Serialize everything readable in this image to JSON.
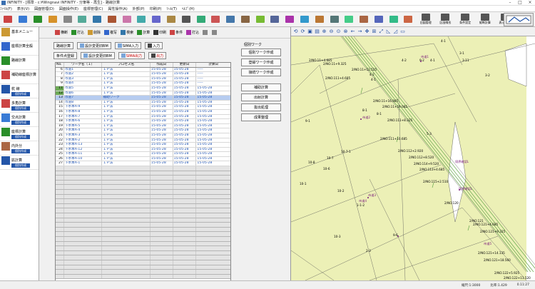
{
  "window": {
    "title": "INFINITY - [標準 - c:¥Wingnavi INFINITY - 分筆等 - 再生] - 路線計算"
  },
  "menu": [
    "ﾌｧｲﾙ(F)",
    "表示(V)",
    "図面管理(D)",
    "図面操作(E)",
    "座標管理(C)",
    "属性操作(A)",
    "外部(P)",
    "印刷(P)",
    "ﾂｰﾙ(T)",
    "ﾍﾙﾌﾟ(H)"
  ],
  "toolbar": [
    "DXF",
    "",
    "",
    "",
    "",
    "",
    "",
    "",
    "",
    "",
    "",
    "",
    "",
    "",
    "",
    "",
    "",
    "",
    "",
    "",
    "",
    "",
    "",
    "",
    "",
    "",
    "",
    ""
  ],
  "toolbar_labels": {
    "kyushin": "旧図管理",
    "tekiyou": "区画線形",
    "jouken": "条件設定",
    "keisan": "縦断計算",
    "hyouji": "表示ﾓｰﾄﾞ",
    "tool": "ツール"
  },
  "sidebar": [
    {
      "label": "基本メニュー"
    },
    {
      "label": "座標計算全般"
    },
    {
      "label": "路線計算"
    },
    {
      "label": "補助線座標計算"
    },
    {
      "label": "杭 線",
      "btn": "個別作成"
    },
    {
      "label": "多角計算",
      "btn": "個別作成"
    },
    {
      "label": "交点計算",
      "btn": "個別作成"
    },
    {
      "label": "座標計算",
      "btn": "個別作成"
    },
    {
      "label": "内外分",
      "btn": "個別作成"
    },
    {
      "label": "拡計算",
      "btn": "個別作成"
    }
  ],
  "subtoolbar": [
    "横断",
    "打込",
    "削除",
    "複写",
    "検索",
    "計算",
    "印刷",
    "条件",
    "打込",
    "",
    ""
  ],
  "controls": {
    "row1": [
      "路線計算",
      "設計変更旧BM",
      "SIMA入力",
      "入力"
    ],
    "row2": [
      "条件点登録",
      "設計変更旧BM",
      "SIMA出力",
      "出力"
    ]
  },
  "right_panel": {
    "heading": "個別ワーク",
    "buttons": [
      "個別ワーク作成",
      "登録ワーク作成",
      "接続ワーク作成"
    ],
    "buttons2": [
      "補助計算",
      "出射計算",
      "抜出処理",
      "成果整理"
    ]
  },
  "grid": {
    "headers": [
      "No.",
      "ワーク名（１）",
      "プロセス名",
      "作成日",
      "更新日",
      "計算日"
    ],
    "rows": [
      {
        "no": "6",
        "name": "市道1",
        "proc": "ＩＰ法",
        "created": "15-05-28",
        "updated": "15-05-28",
        "calc": "-----",
        "type": ""
      },
      {
        "no": "7",
        "name": "市道2",
        "proc": "ＩＰ法",
        "created": "15-05-28",
        "updated": "15-05-28",
        "calc": "-----",
        "type": ""
      },
      {
        "no": "8",
        "name": "市道3",
        "proc": "ＩＰ法",
        "created": "15-05-28",
        "updated": "15-05-28",
        "calc": "-----",
        "type": ""
      },
      {
        "no": "9",
        "name": "市道4",
        "proc": "ＩＰ法",
        "created": "15-05-28",
        "updated": "15-05-28",
        "calc": "-----",
        "type": ""
      },
      {
        "no": "11",
        "name": "市道5",
        "proc": "ＩＰ法",
        "created": "15-05-28",
        "updated": "15-05-28",
        "calc": "15-05-28",
        "type": "green"
      },
      {
        "no": "12",
        "name": "市道6",
        "proc": "ＩＰ法",
        "created": "15-05-28",
        "updated": "15-05-28",
        "calc": "15-05-28",
        "type": "green"
      },
      {
        "no": "13",
        "name": "市道7",
        "proc": "補助ワーク",
        "created": "15-05-28",
        "updated": "15-05-28",
        "calc": "15-05-28",
        "type": "sel"
      },
      {
        "no": "14",
        "name": "市道8",
        "proc": "ＩＰ法",
        "created": "15-05-28",
        "updated": "15-05-28",
        "calc": "15-05-28",
        "type": ""
      },
      {
        "no": "15",
        "name": "下水本A-9",
        "proc": "ＩＰ法",
        "created": "15-05-28",
        "updated": "15-05-28",
        "calc": "15-05-28",
        "type": ""
      },
      {
        "no": "16",
        "name": "下水本A-8",
        "proc": "ＩＰ法",
        "created": "15-05-28",
        "updated": "15-05-28",
        "calc": "15-05-28",
        "type": ""
      },
      {
        "no": "17",
        "name": "下水本A-7",
        "proc": "ＩＰ法",
        "created": "15-05-28",
        "updated": "15-05-28",
        "calc": "15-05-28",
        "type": ""
      },
      {
        "no": "18",
        "name": "下水本A-6",
        "proc": "ＩＰ法",
        "created": "15-05-28",
        "updated": "15-05-28",
        "calc": "15-05-28",
        "type": ""
      },
      {
        "no": "19",
        "name": "下水本A-5",
        "proc": "ＩＰ法",
        "created": "15-05-28",
        "updated": "15-05-28",
        "calc": "15-05-28",
        "type": ""
      },
      {
        "no": "20",
        "name": "下水本A-4",
        "proc": "ＩＰ法",
        "created": "15-05-28",
        "updated": "15-05-28",
        "calc": "15-05-28",
        "type": ""
      },
      {
        "no": "21",
        "name": "下水本A-3",
        "proc": "ＩＰ法",
        "created": "15-05-28",
        "updated": "15-05-28",
        "calc": "15-05-28",
        "type": ""
      },
      {
        "no": "22",
        "name": "下水本A-2",
        "proc": "ＩＰ法",
        "created": "15-05-28",
        "updated": "15-05-28",
        "calc": "15-05-28",
        "type": ""
      },
      {
        "no": "23",
        "name": "下水本A-13",
        "proc": "ＩＰ法",
        "created": "15-05-28",
        "updated": "15-05-28",
        "calc": "15-05-28",
        "type": ""
      },
      {
        "no": "24",
        "name": "下水本A-12",
        "proc": "ＩＰ法",
        "created": "15-05-28",
        "updated": "15-05-28",
        "calc": "15-05-28",
        "type": ""
      },
      {
        "no": "25",
        "name": "下水本A-11",
        "proc": "ＩＰ法",
        "created": "15-05-28",
        "updated": "15-05-28",
        "calc": "15-05-28",
        "type": ""
      },
      {
        "no": "26",
        "name": "下水本A-10",
        "proc": "ＩＰ法",
        "created": "15-05-28",
        "updated": "15-05-28",
        "calc": "15-05-28",
        "type": ""
      },
      {
        "no": "27",
        "name": "下水本A-1",
        "proc": "ＩＰ法",
        "created": "15-05-28",
        "updated": "15-05-28",
        "calc": "15-05-28",
        "type": ""
      }
    ],
    "empty_rows": 24
  },
  "map": {
    "labels": [
      "4-1",
      "4-2",
      "4-1",
      "4-2",
      "4-1",
      "3-11",
      "3-2",
      "3-1",
      "8-1",
      "8-1",
      "5-3",
      "10-7",
      "10-7-1",
      "10-8",
      "10-1",
      "10-3",
      "10-6",
      "10-2",
      "9-6",
      "1-1-2",
      "2-3",
      "9-1",
      "9-2",
      "市道1",
      "市道2",
      "市道3",
      "市道4",
      "境界確認L",
      "境界確認L",
      "市道5",
      "2/NO.11+4.685",
      "2/NO.11+9.325",
      "2/NO.11+12.525",
      "2/NO.11+16.985",
      "2/NO.11+19.085",
      "2/NO.111+4.685",
      "2/NO.111+8.325",
      "2/NO.111+10.685",
      "2/NO.112+2.920",
      "2/NO.112+8.520",
      "2/NO.113+4.685",
      "2/NO.114+9.520",
      "2/NO.115+2.510",
      "2/NO.120",
      "2/NO.121",
      "2/NO.121+4.685",
      "2/NO.121+9.325",
      "2/NO.121+14.135",
      "2/NO.121+18.560",
      "2/NO.122+5.925",
      "2/NO.122+11.520"
    ]
  },
  "status": {
    "scale": "縮尺:1:3000",
    "coord": "Y:-00.000 X:-00.000",
    "zoom": "比率:1.429",
    "time": "0.11:27"
  },
  "colors": {
    "map_bg": "#ecf0b6",
    "road_green": "#6aa84f",
    "selection": "#b6ccf0",
    "status_green": "#6dab56",
    "accent_blue": "#2456a8"
  }
}
